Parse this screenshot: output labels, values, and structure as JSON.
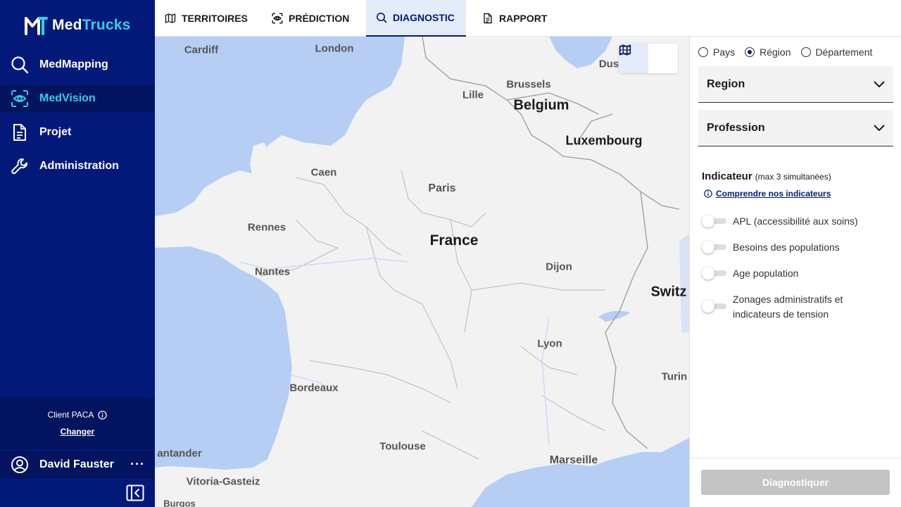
{
  "app": {
    "logo_med": "Med",
    "logo_trucks": "Trucks",
    "brand_color": "#03197a",
    "accent_color": "#2fd0e6"
  },
  "sidebar": {
    "items": [
      {
        "label": "MedMapping",
        "icon": "search-icon",
        "active": false
      },
      {
        "label": "MedVision",
        "icon": "eye-scan-icon",
        "active": true
      },
      {
        "label": "Projet",
        "icon": "document-icon",
        "active": false
      },
      {
        "label": "Administration",
        "icon": "wrench-icon",
        "active": false
      }
    ],
    "client_label": "Client PACA",
    "change_label": "Changer",
    "user_name": "David Fauster",
    "more_label": "···"
  },
  "tabs": [
    {
      "label": "TERRITOIRES",
      "icon": "map-icon",
      "active": false
    },
    {
      "label": "PRÉDICTION",
      "icon": "eye-scan-icon",
      "active": false
    },
    {
      "label": "DIAGNOSTIC",
      "icon": "search-icon",
      "active": true
    },
    {
      "label": "RAPPORT",
      "icon": "document-icon",
      "active": false
    }
  ],
  "map": {
    "countries": {
      "belgium": "Belgium",
      "luxembourg": "Luxembourg",
      "france": "France",
      "switzerland": "Switz"
    },
    "cities": {
      "cardiff": "Cardiff",
      "london": "London",
      "dus": "Dus",
      "brussels": "Brussels",
      "lille": "Lille",
      "caen": "Caen",
      "paris": "Paris",
      "rennes": "Rennes",
      "nantes": "Nantes",
      "dijon": "Dijon",
      "lyon": "Lyon",
      "bordeaux": "Bordeaux",
      "turin": "Turin",
      "toulouse": "Toulouse",
      "marseille": "Marseille",
      "santander": "antander",
      "vitoria": "Vitoria-Gasteiz",
      "burgos": "Burgos"
    },
    "view_mode": "map"
  },
  "panel": {
    "scope_options": [
      {
        "label": "Pays",
        "selected": false
      },
      {
        "label": "Région",
        "selected": true
      },
      {
        "label": "Département",
        "selected": false
      }
    ],
    "region_select": "Region",
    "profession_select": "Profession",
    "indicator_title": "Indicateur",
    "indicator_hint": "(max 3 simultanées)",
    "indicator_link": "Comprendre nos indicateurs",
    "indicators": [
      {
        "label": "APL (accessibilité aux soins)",
        "on": false
      },
      {
        "label": "Besoins des populations",
        "on": false
      },
      {
        "label": "Age population",
        "on": false
      },
      {
        "label": "Zonages administratifs et indicateurs de tension",
        "on": false
      }
    ],
    "diagnose_button": "Diagnostiquer"
  }
}
